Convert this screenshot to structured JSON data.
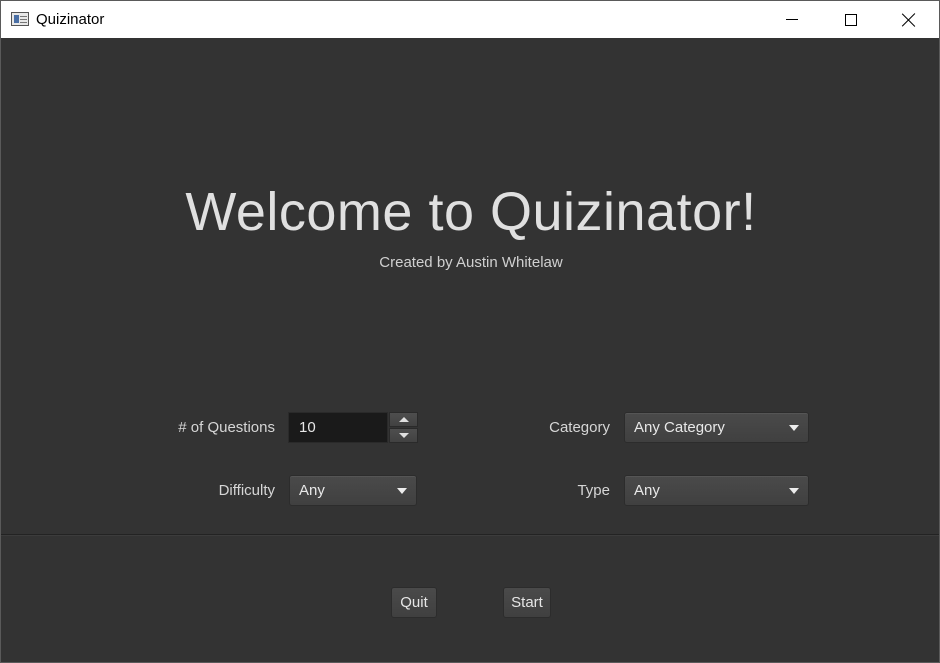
{
  "window": {
    "title": "Quizinator",
    "controls": [
      "minimize-icon",
      "maximize-icon",
      "close-icon"
    ]
  },
  "header": {
    "title": "Welcome to Quizinator!",
    "subtitle": "Created by Austin Whitelaw"
  },
  "form": {
    "questions": {
      "label": "# of Questions",
      "value": "10"
    },
    "category": {
      "label": "Category",
      "value": "Any Category"
    },
    "difficulty": {
      "label": "Difficulty",
      "value": "Any"
    },
    "type": {
      "label": "Type",
      "value": "Any"
    }
  },
  "actions": {
    "quit_label": "Quit",
    "start_label": "Start"
  },
  "colors": {
    "background": "#333333",
    "text": "#e0e0e0",
    "control": "#444444",
    "input_bg": "#1a1a1a"
  }
}
